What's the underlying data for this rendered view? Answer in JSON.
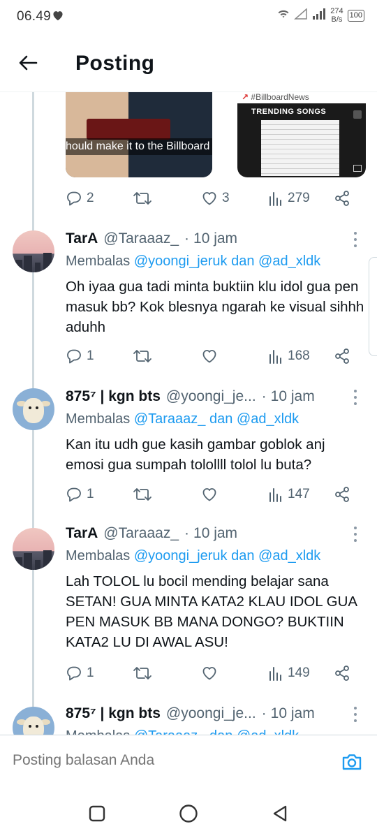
{
  "status_bar": {
    "time": "06.49",
    "net_speed_value": "274",
    "net_speed_unit": "B/s",
    "battery": "100"
  },
  "header": {
    "title": "Posting"
  },
  "media": {
    "left_caption": "hould make it to the Billboard",
    "right_tag": "#BillboardNews",
    "right_board_title": "TRENDING SONGS"
  },
  "parent_actions": {
    "replies": "2",
    "likes": "3",
    "views": "279"
  },
  "tweets": [
    {
      "name": "TarA",
      "handle": "@Taraaaz_",
      "sep": "·",
      "time": "10 jam",
      "reply_prefix": "Membalas",
      "reply_user1": "@yoongi_jeruk",
      "reply_joiner": "dan",
      "reply_user2": "@ad_xldk",
      "text": "Oh iyaa gua tadi minta buktiin klu idol gua pen masuk bb? Kok blesnya ngarah ke visual sihhh aduhh",
      "replies": "1",
      "likes": "",
      "views": "168"
    },
    {
      "name": "875⁷ | kgn bts",
      "handle": "@yoongi_je...",
      "sep": "·",
      "time": "10 jam",
      "reply_prefix": "Membalas",
      "reply_user1": "@Taraaaz_",
      "reply_joiner": "dan",
      "reply_user2": "@ad_xldk",
      "text": "Kan itu udh gue kasih gambar goblok anj emosi gua sumpah tolollll tolol lu buta?",
      "replies": "1",
      "likes": "",
      "views": "147"
    },
    {
      "name": "TarA",
      "handle": "@Taraaaz_",
      "sep": "·",
      "time": "10 jam",
      "reply_prefix": "Membalas",
      "reply_user1": "@yoongi_jeruk",
      "reply_joiner": "dan",
      "reply_user2": "@ad_xldk",
      "text": "Lah TOLOL lu bocil mending belajar sana SETAN! GUA MINTA KATA2 KLAU IDOL GUA PEN MASUK BB MANA DONGO? BUKTIIN KATA2 LU DI AWAL ASU!",
      "replies": "1",
      "likes": "",
      "views": "149"
    },
    {
      "name": "875⁷ | kgn bts",
      "handle": "@yoongi_je...",
      "sep": "·",
      "time": "10 jam",
      "reply_prefix": "Membalas",
      "reply_user1": "@Taraaaz_",
      "reply_joiner": "dan",
      "reply_user2": "@ad_xldk"
    }
  ],
  "composer": {
    "placeholder": "Posting balasan Anda"
  },
  "colors": {
    "accent": "#1d9bf0",
    "secondary_text": "#536471",
    "thread_line": "#cfd9de"
  },
  "icons": {
    "back": "arrow-left-icon",
    "reply": "reply-icon",
    "retweet": "retweet-icon",
    "like": "heart-icon",
    "views": "views-icon",
    "share": "share-icon",
    "camera": "camera-icon"
  }
}
